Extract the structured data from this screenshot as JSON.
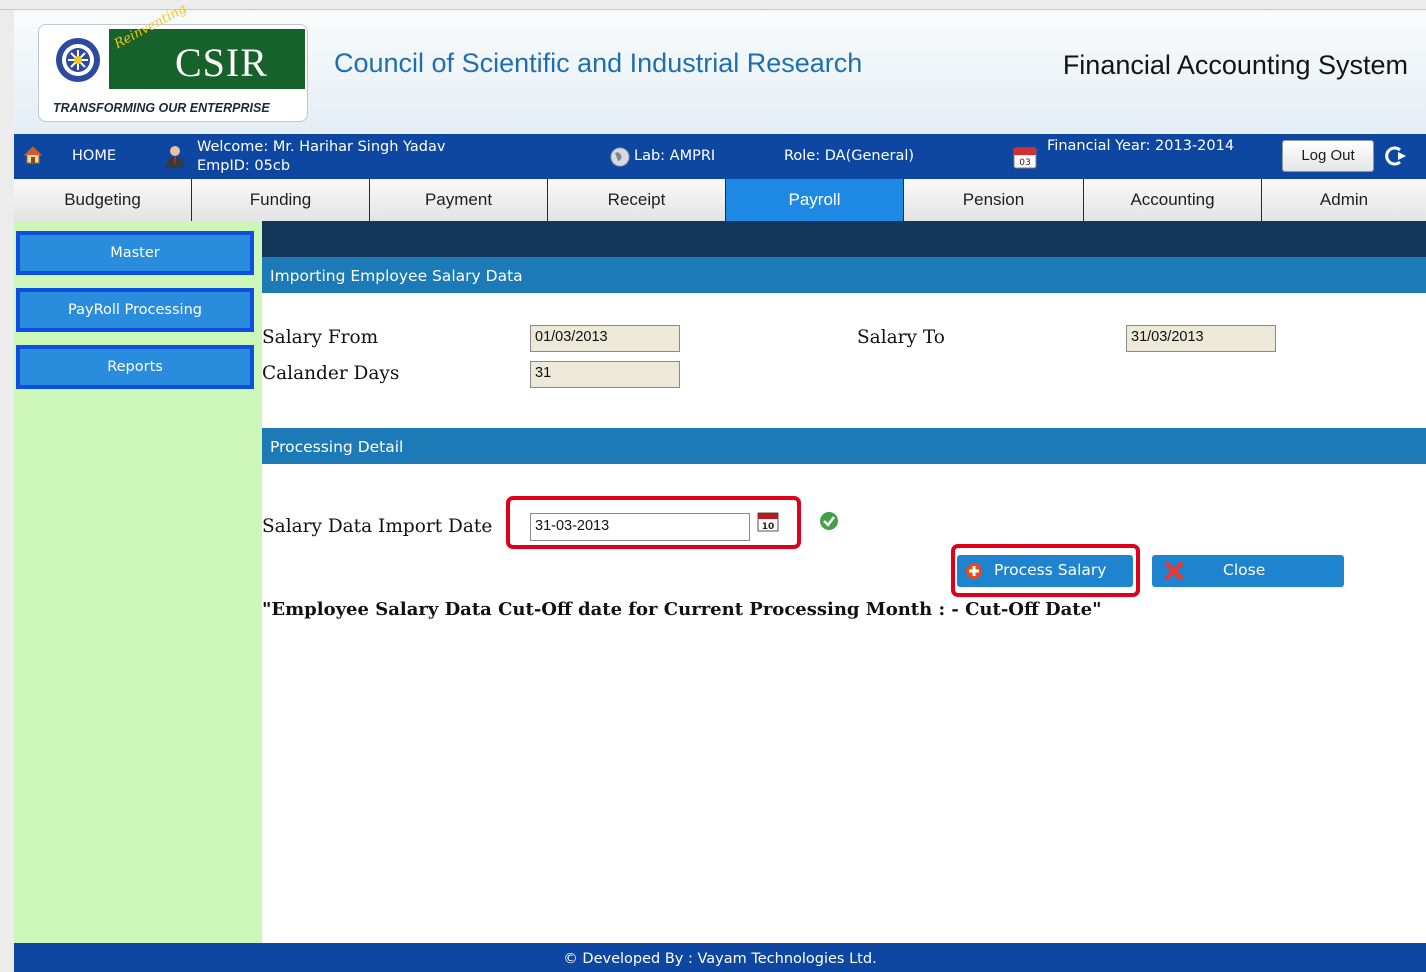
{
  "header": {
    "logo_reinventing": "Reinventing",
    "logo_csir": "CSIR",
    "logo_tagline": "TRANSFORMING OUR ENTERPRISE",
    "org_name": "Council of Scientific and Industrial Research",
    "system_name": "Financial Accounting System"
  },
  "infobar": {
    "home_label": "HOME",
    "welcome_line1": "Welcome: Mr. Harihar Singh Yadav",
    "welcome_line2": "EmpID: 05cb",
    "lab": "Lab: AMPRI",
    "role": "Role: DA(General)",
    "financial_year": "Financial Year: 2013-2014",
    "logout_label": "Log Out",
    "calendar_day": "03"
  },
  "tabs": [
    {
      "label": "Budgeting",
      "active": false
    },
    {
      "label": "Funding",
      "active": false
    },
    {
      "label": "Payment",
      "active": false
    },
    {
      "label": "Receipt",
      "active": false
    },
    {
      "label": "Payroll",
      "active": true
    },
    {
      "label": "Pension",
      "active": false
    },
    {
      "label": "Accounting",
      "active": false
    },
    {
      "label": "Admin",
      "active": false
    }
  ],
  "sidebar": {
    "items": [
      {
        "label": "Master"
      },
      {
        "label": "PayRoll Processing"
      },
      {
        "label": "Reports"
      }
    ]
  },
  "import_section": {
    "title": "Importing Employee Salary Data",
    "salary_from_label": "Salary From",
    "salary_from_value": "01/03/2013",
    "salary_to_label": "Salary To",
    "salary_to_value": "31/03/2013",
    "calendar_days_label": "Calander Days",
    "calendar_days_value": "31"
  },
  "processing_section": {
    "title": "Processing Detail",
    "import_date_label": "Salary Data Import Date",
    "import_date_value": "31-03-2013",
    "date_picker_day": "10",
    "process_button_label": "Process Salary",
    "close_button_label": "Close",
    "cutoff_text": "\"Employee Salary Data Cut-Off date for Current Processing Month : -    Cut-Off Date\""
  },
  "footer": {
    "text": "© Developed By : Vayam Technologies Ltd."
  },
  "colors": {
    "brand_blue": "#0d47a1",
    "tab_active": "#1e88e5",
    "section_bar": "#1c7ab6",
    "sidebar_bg": "#ccf7b8",
    "logo_green": "#17612a",
    "highlight_red": "#e0001b"
  }
}
